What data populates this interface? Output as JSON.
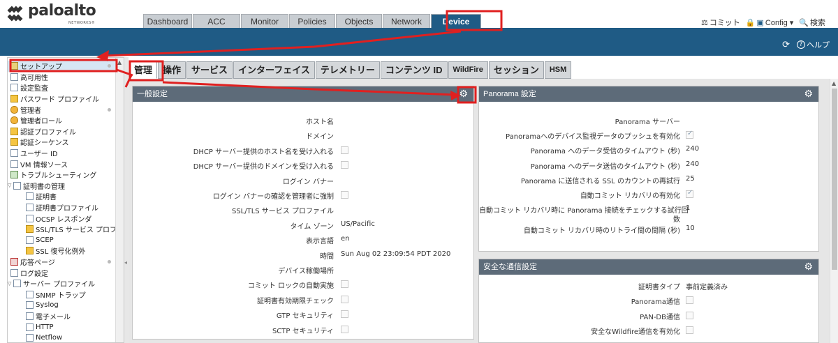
{
  "brand": {
    "name": "paloalto",
    "sub": "NETWORKS®",
    "color": "#1f5b85"
  },
  "top_tabs": [
    "Dashboard",
    "ACC",
    "Monitor",
    "Policies",
    "Objects",
    "Network",
    "Device"
  ],
  "active_top_tab": "Device",
  "header_actions": {
    "commit": "コミット",
    "config": "Config ▾",
    "search": "検索"
  },
  "band": {
    "help": "ヘルプ"
  },
  "sidebar": {
    "items": [
      {
        "label": "セットアップ",
        "icon": "gear",
        "selected": true,
        "dot": true
      },
      {
        "label": "高可用性",
        "icon": "doc"
      },
      {
        "label": "設定監査",
        "icon": "doc"
      },
      {
        "label": "パスワード プロファイル",
        "icon": "lock"
      },
      {
        "label": "管理者",
        "icon": "person",
        "dot": true
      },
      {
        "label": "管理者ロール",
        "icon": "person"
      },
      {
        "label": "認証プロファイル",
        "icon": "lock"
      },
      {
        "label": "認証シーケンス",
        "icon": "lock"
      },
      {
        "label": "ユーザー ID",
        "icon": "doc"
      },
      {
        "label": "VM 情報ソース",
        "icon": "doc"
      },
      {
        "label": "トラブルシューティング",
        "icon": "green"
      },
      {
        "label": "証明書の管理",
        "icon": "doc",
        "tree": true
      },
      {
        "label": "証明書",
        "icon": "doc",
        "indent": 1
      },
      {
        "label": "証明書プロファイル",
        "icon": "doc",
        "indent": 1
      },
      {
        "label": "OCSP レスポンダ",
        "icon": "doc",
        "indent": 1
      },
      {
        "label": "SSL/TLS サービス プロファ",
        "icon": "lock",
        "indent": 1
      },
      {
        "label": "SCEP",
        "icon": "doc",
        "indent": 1
      },
      {
        "label": "SSL 復号化例外",
        "icon": "lock",
        "indent": 1
      },
      {
        "label": "応答ページ",
        "icon": "red",
        "dot": true
      },
      {
        "label": "ログ設定",
        "icon": "doc"
      },
      {
        "label": "サーバー プロファイル",
        "icon": "doc",
        "tree": true
      },
      {
        "label": "SNMP トラップ",
        "icon": "doc",
        "indent": 1
      },
      {
        "label": "Syslog",
        "icon": "doc",
        "indent": 1
      },
      {
        "label": "電子メール",
        "icon": "doc",
        "indent": 1
      },
      {
        "label": "HTTP",
        "icon": "doc",
        "indent": 1
      },
      {
        "label": "Netflow",
        "icon": "doc",
        "indent": 1
      }
    ]
  },
  "sub_tabs": [
    "管理",
    "操作",
    "サービス",
    "インターフェイス",
    "テレメトリー",
    "コンテンツ ID",
    "WildFire",
    "セッション",
    "HSM"
  ],
  "active_sub_tab": "管理",
  "general": {
    "title": "一般設定",
    "rows": [
      {
        "label": "ホスト名",
        "value": ""
      },
      {
        "label": "ドメイン",
        "value": ""
      },
      {
        "label": "DHCP サーバー提供のホスト名を受け入れる",
        "checkbox": true
      },
      {
        "label": "DHCP サーバー提供のドメインを受け入れる",
        "checkbox": true
      },
      {
        "label": "ログイン バナー",
        "value": ""
      },
      {
        "label": "ログイン バナーの確認を管理者に強制",
        "checkbox": true
      },
      {
        "label": "SSL/TLS サービス プロファイル",
        "value": ""
      },
      {
        "label": "タイム ゾーン",
        "value": "US/Pacific"
      },
      {
        "label": "表示言語",
        "value": "en"
      },
      {
        "label": "時間",
        "value": "Sun Aug 02 23:09:54 PDT 2020"
      },
      {
        "label": "デバイス稼働場所",
        "value": ""
      },
      {
        "label": "コミット ロックの自動実施",
        "checkbox": true
      },
      {
        "label": "証明書有効期限チェック",
        "checkbox": true
      },
      {
        "label": "GTP セキュリティ",
        "checkbox": true
      },
      {
        "label": "SCTP セキュリティ",
        "checkbox": true
      }
    ]
  },
  "panorama": {
    "title": "Panorama 設定",
    "rows": [
      {
        "label": "Panorama サーバー",
        "value": ""
      },
      {
        "label": "Panoramaへのデバイス監視データのプッシュを有効化",
        "checkbox": true,
        "checked": true
      },
      {
        "label": "Panorama へのデータ受信のタイムアウト (秒)",
        "value": "240"
      },
      {
        "label": "Panorama へのデータ送信のタイムアウト (秒)",
        "value": "240"
      },
      {
        "label": "Panorama に送信される SSL のカウントの再試行",
        "value": "25"
      },
      {
        "label": "自動コミット リカバリの有効化",
        "checkbox": true,
        "checked": true
      },
      {
        "label": "自動コミット リカバリ時に Panorama 接続をチェックする試行回",
        "label2": "数",
        "value": "1"
      },
      {
        "label": "自動コミット リカバリ時のリトライ間の間隔 (秒)",
        "value": "10"
      }
    ]
  },
  "secure": {
    "title": "安全な通信設定",
    "rows": [
      {
        "label": "証明書タイプ",
        "value": "事前定義済み"
      },
      {
        "label": "Panorama通信",
        "checkbox": true
      },
      {
        "label": "PAN-DB通信",
        "checkbox": true
      },
      {
        "label": "安全なWildfire通信を有効化",
        "checkbox": true
      }
    ]
  }
}
